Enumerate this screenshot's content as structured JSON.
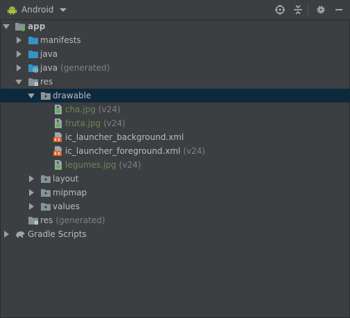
{
  "header": {
    "view_label": "Android",
    "icons": [
      "android-icon",
      "chevron-down-icon",
      "target-icon",
      "collapse-icon",
      "gear-icon",
      "minimize-icon"
    ]
  },
  "tree": {
    "app": "app",
    "manifests": "manifests",
    "java": "java",
    "java_gen": "java",
    "java_gen_suffix": "(generated)",
    "res": "res",
    "drawable": "drawable",
    "files": [
      {
        "name": "cha.jpg",
        "suffix": "(v24)"
      },
      {
        "name": "fruta.jpg",
        "suffix": "(v24)"
      },
      {
        "name": "ic_launcher_background.xml",
        "suffix": ""
      },
      {
        "name": "ic_launcher_foreground.xml",
        "suffix": "(v24)"
      },
      {
        "name": "legumes.jpg",
        "suffix": "(v24)"
      }
    ],
    "layout": "layout",
    "mipmap": "mipmap",
    "values": "values",
    "res_gen": "res",
    "res_gen_suffix": "(generated)",
    "gradle": "Gradle Scripts"
  },
  "colors": {
    "background": "#3c3f41",
    "selection": "#0d293e",
    "text": "#bbbbbb",
    "vcs_added": "#6a8759",
    "muted": "#808080"
  }
}
